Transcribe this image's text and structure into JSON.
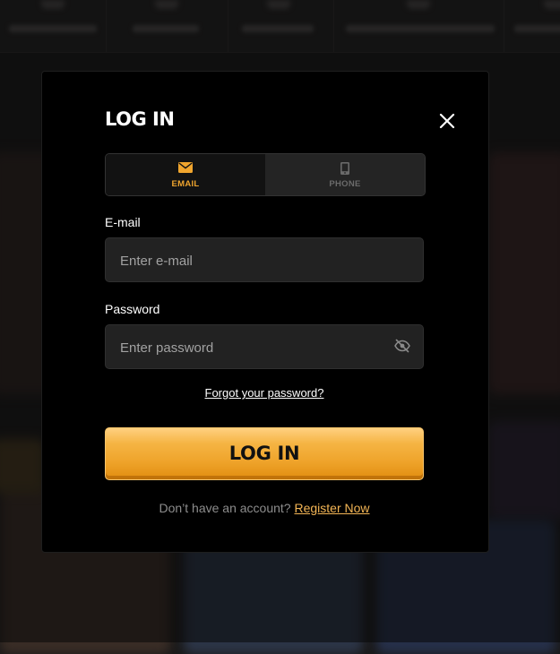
{
  "modal": {
    "title": "LOG IN",
    "close_icon": "close-icon",
    "tabs": [
      {
        "label": "EMAIL",
        "icon": "envelope-icon",
        "active": true
      },
      {
        "label": "PHONE",
        "icon": "phone-icon",
        "active": false
      }
    ],
    "email": {
      "label": "E-mail",
      "placeholder": "Enter e-mail",
      "value": ""
    },
    "password": {
      "label": "Password",
      "placeholder": "Enter password",
      "value": "",
      "toggle_icon": "eye-slash-icon"
    },
    "forgot_link": "Forgot your password?",
    "login_button": "LOG IN",
    "register_prompt": "Don’t have an account?",
    "register_link": "Register Now"
  },
  "colors": {
    "accent": "#f0a52e",
    "modal_bg": "#000000",
    "input_bg": "#222222",
    "muted_text": "#8d8d8d",
    "link": "#f3b555"
  }
}
